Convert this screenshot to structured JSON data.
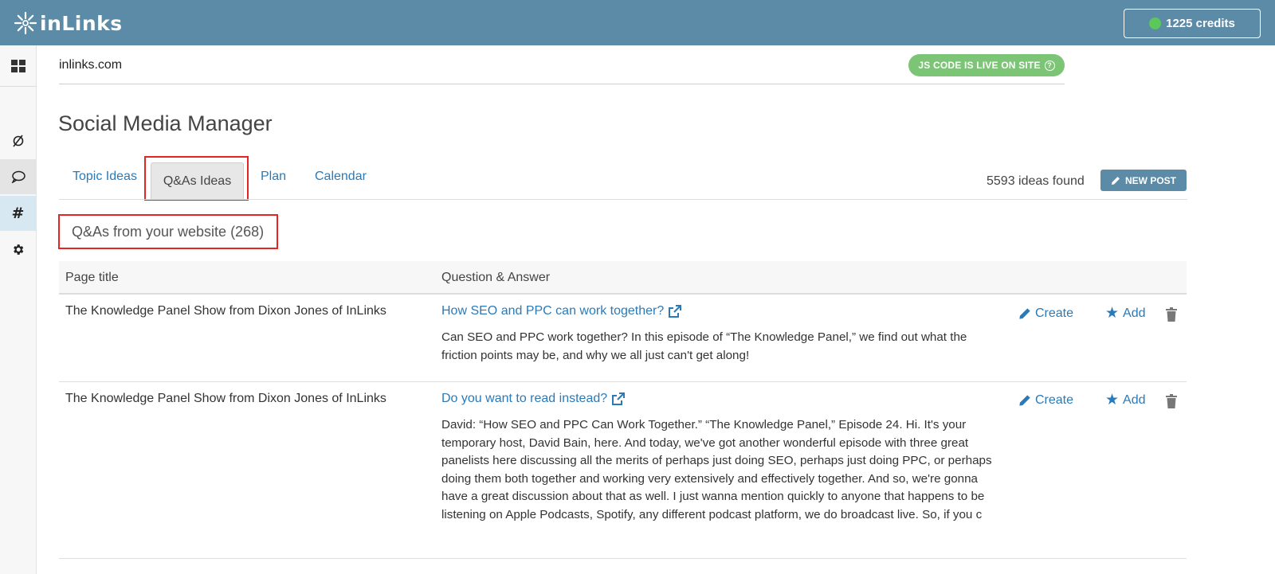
{
  "app": {
    "logo_text": "inLinks",
    "credits": "1225 credits",
    "status_color": "#5cc85c",
    "topbar_color": "#5b8ba7"
  },
  "sidebar": {
    "items": [
      {
        "icon": "grid-icon"
      },
      {
        "icon": "topic-icon"
      },
      {
        "icon": "chat-bubble-icon"
      },
      {
        "icon": "hashtag-icon"
      },
      {
        "icon": "gear-icon"
      }
    ]
  },
  "site": {
    "domain": "inlinks.com",
    "live_badge": "JS CODE IS LIVE ON SITE"
  },
  "page": {
    "title": "Social Media Manager"
  },
  "tabs": [
    {
      "label": "Topic Ideas"
    },
    {
      "label": "Q&As Ideas"
    },
    {
      "label": "Plan"
    },
    {
      "label": "Calendar"
    }
  ],
  "toolbar": {
    "ideas_found": "5593 ideas found",
    "new_post_label": "NEW POST"
  },
  "section": {
    "title": "Q&As from your website (268)"
  },
  "table": {
    "headers": [
      "Page title",
      "Question & Answer"
    ],
    "rows": [
      {
        "page_title": "The Knowledge Panel Show from Dixon Jones of InLinks",
        "question": "How SEO and PPC can work together?",
        "answer": "Can SEO and PPC work together? In this episode of “The Knowledge Panel,” we find out what the friction points may be, and why we all just can't get along!",
        "create_label": "Create",
        "add_label": "Add"
      },
      {
        "page_title": "The Knowledge Panel Show from Dixon Jones of InLinks",
        "question": "Do you want to read instead?",
        "answer": "David: “How SEO and PPC Can Work Together.” “The Knowledge Panel,” Episode 24. Hi. It's your temporary host, David Bain, here. And today, we've got another wonderful episode with three great panelists here discussing all the merits of perhaps just doing SEO, perhaps just doing PPC, or perhaps doing them both together and working very extensively and effectively together. And so, we're gonna have a great discussion about that as well. I just wanna mention quickly to anyone that happens to be listening on Apple Podcasts, Spotify, any different podcast platform, we do broadcast live. So, if you c",
        "create_label": "Create",
        "add_label": "Add"
      }
    ]
  }
}
